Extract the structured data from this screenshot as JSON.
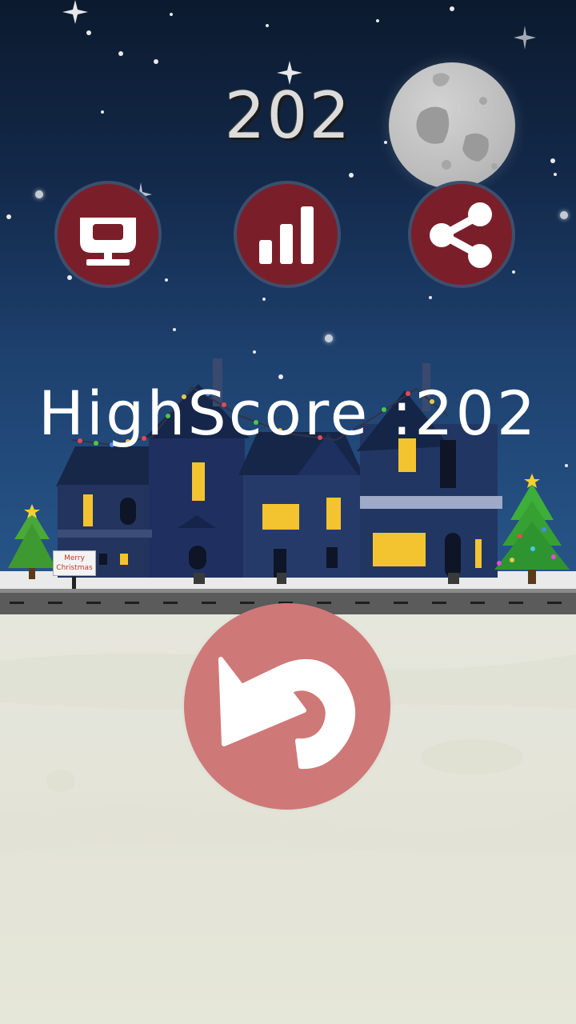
{
  "game": {
    "score": "202",
    "highscore_label": "HighScore : ",
    "highscore_value": "202",
    "sign_text_line1": "Merry",
    "sign_text_line2": "Christmas"
  },
  "buttons": {
    "leaderboard": "trophy-icon",
    "stats": "bar-chart-icon",
    "share": "share-icon",
    "replay": "replay-icon"
  },
  "colors": {
    "button_fill": "#7a1f2a",
    "replay_fill": "#cf7878",
    "sky_top": "#0b1a2e",
    "sky_bottom": "#27568a",
    "window_light": "#f4c430"
  }
}
